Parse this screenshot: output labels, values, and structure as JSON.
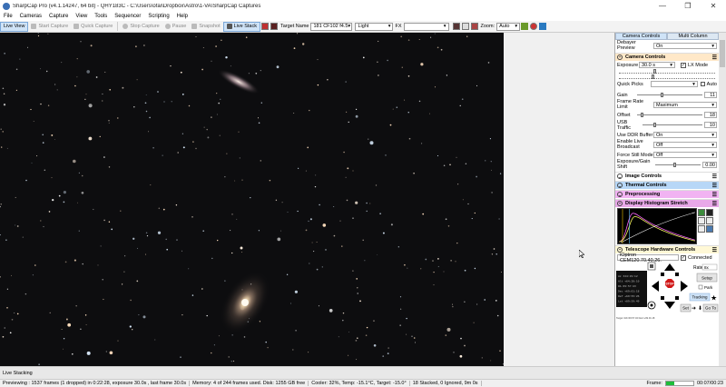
{
  "window": {
    "title": "SharpCap Pro (v4.1.14247, 64 bit) - QHY183C - C:\\Users\\ofai\\Dropbox\\Astro\\1-VA\\SharpCap Captures",
    "minimize": "—",
    "maximize": "❐",
    "close": "✕"
  },
  "menu": [
    "File",
    "Cameras",
    "Capture",
    "View",
    "Tools",
    "Sequencer",
    "Scripting",
    "Help"
  ],
  "toolbar": {
    "live_view": "Live View",
    "start_capture": "Start Capture",
    "quick_capture": "Quick Capture",
    "stop_capture": "Stop Capture",
    "pause": "Pause",
    "snapshot": "Snapshot",
    "live_stack": "Live Stack",
    "target_name_label": "Target Name",
    "target_name_value": "181 CF102 f4.5",
    "frame_type": "Light",
    "fx_label": "FX",
    "fx_value": "",
    "zoom_label": "Zoom:",
    "zoom_value": "Auto"
  },
  "panel": {
    "tabs": [
      "Camera Controls",
      "Multi Column"
    ],
    "debayer_label": "Debayer Preview",
    "debayer_value": "On",
    "camera_controls_title": "Camera Controls",
    "exposure_label": "Exposure",
    "exposure_value": "30.0 s",
    "lx_mode_label": "LX Mode",
    "quick_picks_label": "Quick Picks",
    "auto_label": "Auto",
    "gain_label": "Gain",
    "gain_value": "11",
    "frame_rate_label": "Frame Rate Limit",
    "frame_rate_value": "Maximum",
    "offset_label": "Offset",
    "offset_value": "18",
    "usb_label": "USB Traffic",
    "usb_value": "10",
    "ddr_label": "Use DDR Buffer",
    "ddr_value": "On",
    "live_broadcast_label": "Enable Live Broadcast",
    "live_broadcast_value": "Off",
    "force_still_label": "Force Still Mode",
    "force_still_value": "Off",
    "exposure_gain_label": "Exposure/Gain Shift",
    "exposure_gain_value": "0.00",
    "image_controls": "Image Controls",
    "thermal_controls": "Thermal Controls",
    "preprocessing": "Preprocessing",
    "histogram_stretch": "Display Histogram Stretch",
    "telescope_title": "Telescope Hardware Controls",
    "mount_name": "iOptron CEM120.70.40.26.",
    "connected_label": "Connected",
    "rate_label": "Rate:",
    "rate_value": "8x",
    "setup_label": "Setup",
    "park_label": "Park",
    "tracking_label": "Tracking",
    "stop_label": "STOP",
    "set_label": "Set",
    "goto_label": "Go To",
    "coords": [
      "Az   324:29:12",
      "Alt  +64:20:10",
      "RA   09:57:43",
      "Dec  +69:01:18",
      "Ref  +69:55:26",
      "Lst  +09:59:49"
    ],
    "footer_line": "Target: RA=09.57.43 Dec=+69.01.18"
  },
  "status": {
    "live_stacking": "Live Stacking",
    "previewing": "Previewing : 1537 frames (1 dropped) in 0:22:28, exposure 30.0s , last frame 30.0s",
    "memory": "Memory: 4 of 244 frames used. Disk: 1255 GB free",
    "cooler": "Cooler: 32%, Temp: -15.1°C, Target: -15.0°",
    "stacked": "18 Stacked, 0 Ignored, 9m 0s",
    "frame_label": "Frame:",
    "frame_time": "00:07/00:23",
    "frame_progress": 0.3
  },
  "colors": {
    "sky": "#0d0d0f",
    "accent": "#cfe3f7",
    "progress": "#1fbd3a"
  }
}
